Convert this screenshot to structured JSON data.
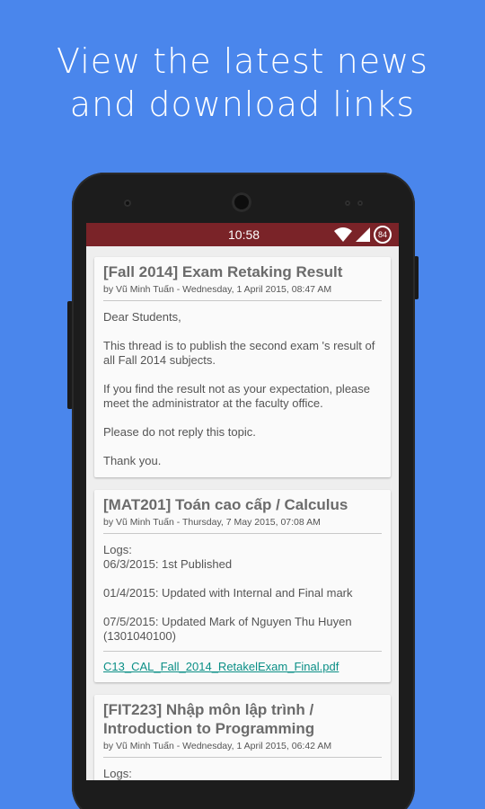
{
  "headline": {
    "line1": "View the latest news",
    "line2": "and download links"
  },
  "status_bar": {
    "time": "10:58",
    "battery": "84",
    "color": "#7a2328"
  },
  "posts": [
    {
      "title": "[Fall 2014] Exam Retaking Result",
      "meta": "by Vũ Minh Tuấn - Wednesday, 1 April 2015, 08:47 AM",
      "paragraphs": [
        "Dear Students,",
        "This thread is to publish the second exam 's result of all Fall 2014 subjects.",
        "If you find the result not as your expectation, please meet the administrator at the faculty office.",
        "Please do not reply this topic.",
        "Thank you."
      ]
    },
    {
      "title": "[MAT201] Toán cao cấp / Calculus",
      "meta": "by Vũ Minh Tuấn - Thursday, 7 May 2015, 07:08 AM",
      "logs_label": "Logs:",
      "logs": [
        "06/3/2015: 1st Published",
        "01/4/2015: Updated with Internal and Final mark",
        "07/5/2015: Updated Mark of Nguyen Thu Huyen (1301040100)"
      ],
      "attachment": "C13_CAL_Fall_2014_RetakelExam_Final.pdf"
    },
    {
      "title": "[FIT223] Nhập môn lập trình / Introduction to Programming",
      "meta": "by Vũ Minh Tuấn - Wednesday, 1 April 2015, 06:42 AM",
      "logs_label": "Logs:"
    }
  ],
  "colors": {
    "background": "#4a86ec",
    "link": "#0a8f86"
  }
}
